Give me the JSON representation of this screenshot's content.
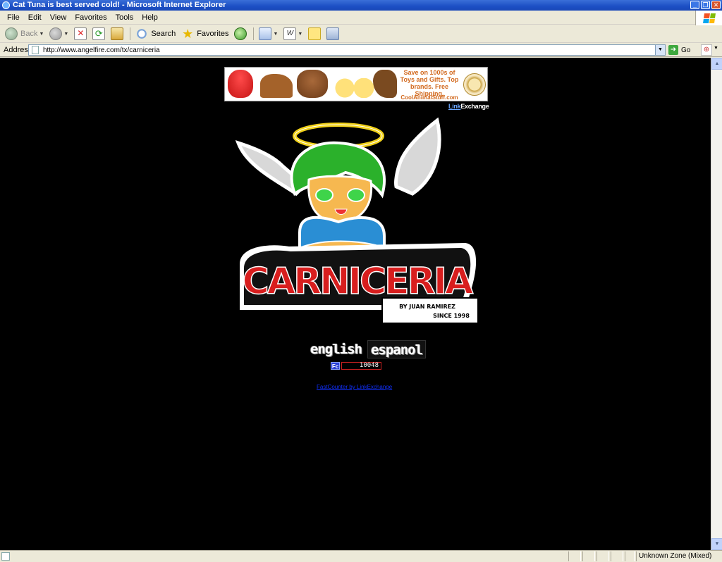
{
  "window": {
    "title": "Cat Tuna is best served cold! - Microsoft Internet Explorer",
    "buttons": {
      "minimize": "_",
      "maximize": "❐",
      "close": "✕"
    }
  },
  "menu": {
    "items": [
      "File",
      "Edit",
      "View",
      "Favorites",
      "Tools",
      "Help"
    ]
  },
  "toolbar": {
    "back_label": "Back",
    "search_label": "Search",
    "favorites_label": "Favorites"
  },
  "address": {
    "label": "Address",
    "url": "http://www.angelfire.com/tx/carniceria",
    "go_label": "Go"
  },
  "banner": {
    "text": "Save on 1000s of Toys and Gifts. Top brands. Free Shipping.",
    "site": "CoolAnimalStuff.com",
    "network_a": "Link",
    "network_b": "Exchange"
  },
  "logo": {
    "title": "CARNICERIA",
    "byline_1": "BY JUAN RAMIREZ",
    "byline_2": "SINCE 1998"
  },
  "language": {
    "english": "english",
    "espanol": "espanol"
  },
  "counter": {
    "badge": "Fc",
    "value": "10048",
    "link": "FastCounter by LinkExchange"
  },
  "status": {
    "text": "",
    "zone": "Unknown Zone (Mixed)"
  },
  "colors": {
    "page_bg": "#000000",
    "logo_red": "#d81e1e",
    "hair_green": "#2bb12b",
    "halo_yellow": "#f2d21a"
  }
}
